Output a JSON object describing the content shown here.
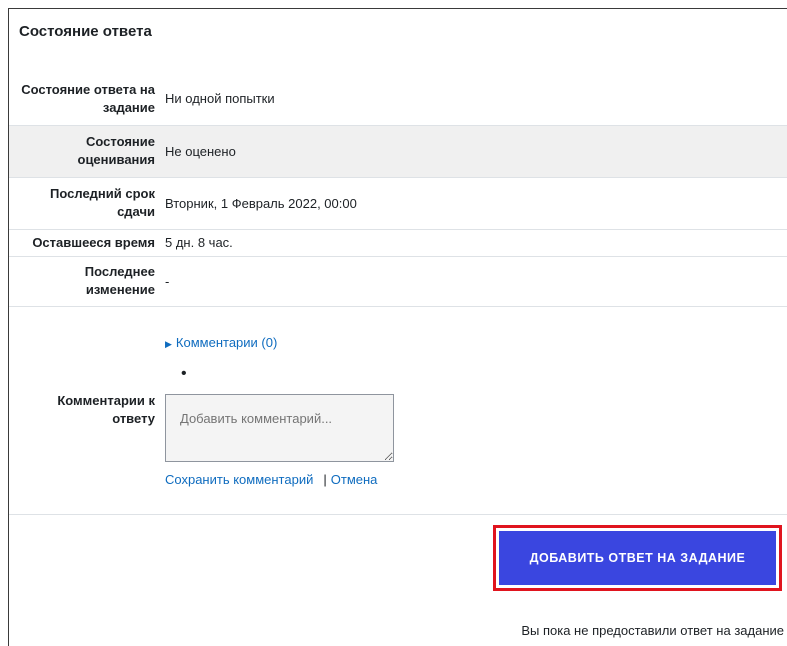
{
  "section": {
    "title": "Состояние ответа"
  },
  "rows": [
    {
      "label": "Состояние ответа на задание",
      "value": "Ни одной попытки"
    },
    {
      "label": "Состояние оценивания",
      "value": "Не оценено"
    },
    {
      "label": "Последний срок сдачи",
      "value": "Вторник, 1 Февраль 2022, 00:00"
    },
    {
      "label": "Оставшееся время",
      "value": "5 дн. 8 час."
    },
    {
      "label": "Последнее изменение",
      "value": "-"
    },
    {
      "label": "Комментарии к ответу",
      "value": ""
    }
  ],
  "comments": {
    "toggle_label": "Комментарии (0)",
    "placeholder": "Добавить комментарий...",
    "save_label": "Сохранить комментарий",
    "separator": "|",
    "cancel_label": "Отмена"
  },
  "action": {
    "button_label": "ДОБАВИТЬ ОТВЕТ НА ЗАДАНИЕ",
    "note": "Вы пока не предоставили ответ на задание",
    "highlight_color": "#e0141e",
    "button_color": "#3a46e0"
  },
  "icons": {
    "toggle": "triangle-right-icon",
    "bullet": "bullet-icon"
  }
}
